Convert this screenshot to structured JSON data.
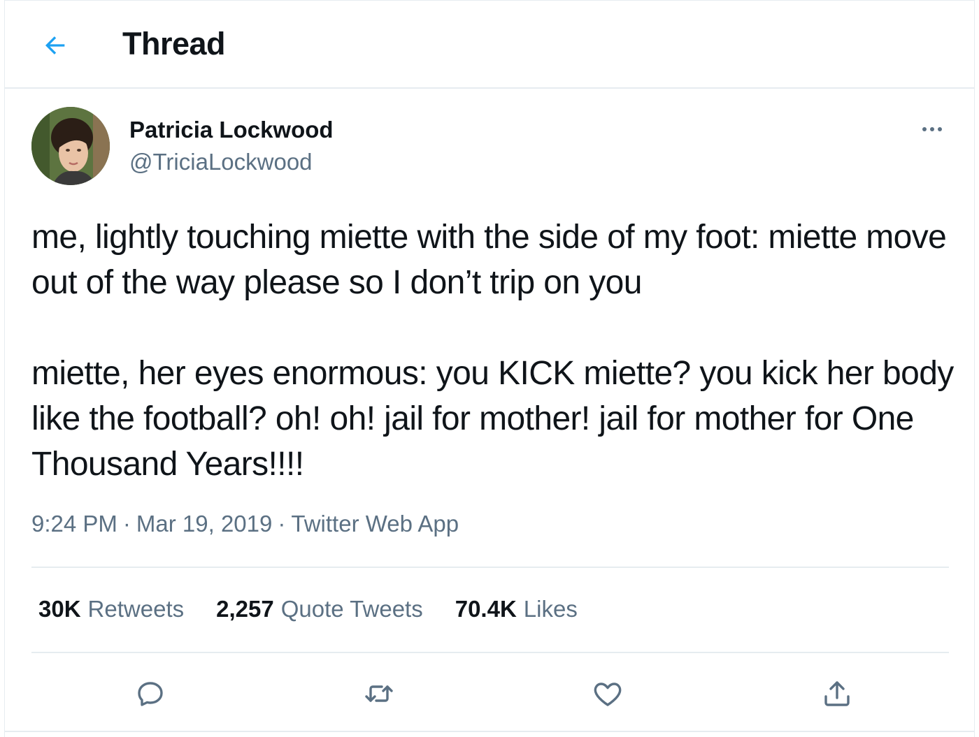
{
  "header": {
    "title": "Thread",
    "back_icon": "arrow-left-icon"
  },
  "tweet": {
    "author": {
      "display_name": "Patricia Lockwood",
      "handle": "@TriciaLockwood"
    },
    "text_paragraphs": [
      "me, lightly touching miette with the side of my foot: miette move out of the way please so I don’t trip on you",
      "miette, her eyes enormous: you KICK miette? you kick her body like the football? oh! oh! jail for mother! jail for mother for One Thousand Years!!!!"
    ],
    "time": "9:24 PM",
    "date": "Mar 19, 2019",
    "source": "Twitter Web App",
    "separator": "·",
    "stats": {
      "retweets_count": "30K",
      "retweets_label": "Retweets",
      "quotes_count": "2,257",
      "quotes_label": "Quote Tweets",
      "likes_count": "70.4K",
      "likes_label": "Likes"
    }
  },
  "colors": {
    "accent": "#1da1f2",
    "secondary_text": "#5b7083",
    "divider": "#e6ecf0"
  },
  "actions": [
    "reply-icon",
    "retweet-icon",
    "like-icon",
    "share-icon"
  ]
}
